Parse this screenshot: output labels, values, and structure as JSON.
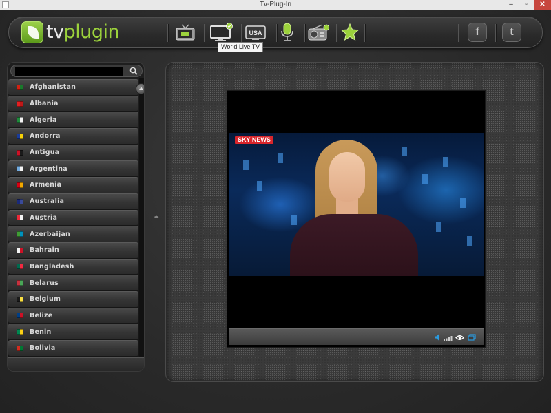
{
  "window": {
    "title": "Tv-Plug-In",
    "controls": {
      "minimize": "–",
      "maximize": "▫",
      "close": "✕"
    }
  },
  "toolbar": {
    "logo": {
      "part1": "tv",
      "part2": "plugin"
    },
    "icons": [
      {
        "name": "local-tv-icon"
      },
      {
        "name": "world-live-tv-icon"
      },
      {
        "name": "usa-tv-icon",
        "label": "USA"
      },
      {
        "name": "microphone-icon"
      },
      {
        "name": "radio-icon"
      },
      {
        "name": "favorites-star-icon"
      }
    ],
    "social": {
      "facebook": "f",
      "twitter": "t"
    },
    "tooltip": "World Live TV"
  },
  "sidebar": {
    "search": {
      "placeholder": "",
      "value": ""
    },
    "countries": [
      {
        "name": "Afghanistan",
        "flag": [
          "#d32011",
          "#1a7a2c"
        ]
      },
      {
        "name": "Albania",
        "flag": [
          "#e41e20",
          "#c01818"
        ]
      },
      {
        "name": "Algeria",
        "flag": [
          "#1f8a3c",
          "#f4f4f4"
        ]
      },
      {
        "name": "Andorra",
        "flag": [
          "#1a3c9a",
          "#f7d208"
        ]
      },
      {
        "name": "Antigua",
        "flag": [
          "#ce1126",
          "#1a1a1a"
        ]
      },
      {
        "name": "Argentina",
        "flag": [
          "#74acdf",
          "#f4f4f4"
        ]
      },
      {
        "name": "Armenia",
        "flag": [
          "#d90012",
          "#f2a800"
        ]
      },
      {
        "name": "Australia",
        "flag": [
          "#1a2a7a",
          "#3a4a9a"
        ]
      },
      {
        "name": "Austria",
        "flag": [
          "#ed2939",
          "#f4f4f4"
        ]
      },
      {
        "name": "Azerbaijan",
        "flag": [
          "#3f9c35",
          "#0092bc"
        ]
      },
      {
        "name": "Bahrain",
        "flag": [
          "#f4f4f4",
          "#ce1126"
        ]
      },
      {
        "name": "Bangladesh",
        "flag": [
          "#006a4e",
          "#f42a41"
        ]
      },
      {
        "name": "Belarus",
        "flag": [
          "#c8313e",
          "#4aa657"
        ]
      },
      {
        "name": "Belgium",
        "flag": [
          "#1a1a1a",
          "#fae042"
        ]
      },
      {
        "name": "Belize",
        "flag": [
          "#003f87",
          "#ce1126"
        ]
      },
      {
        "name": "Benin",
        "flag": [
          "#008751",
          "#fcd116"
        ]
      },
      {
        "name": "Bolivia",
        "flag": [
          "#d52b1e",
          "#007934"
        ]
      }
    ]
  },
  "player": {
    "channel_badge": "SKY NEWS",
    "controls": [
      "volume-icon",
      "signal-icon",
      "eye-icon",
      "fullscreen-icon"
    ]
  },
  "colors": {
    "accent_green": "#9cd23c",
    "control_blue": "#2a9be0"
  }
}
